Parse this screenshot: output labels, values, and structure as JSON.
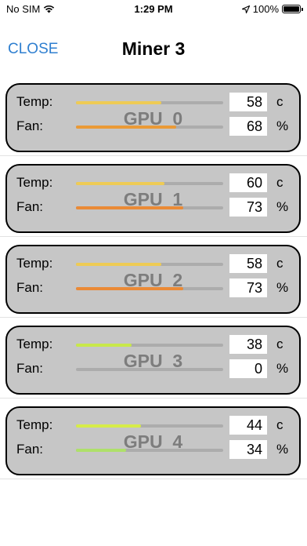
{
  "status_bar": {
    "carrier": "No SIM",
    "time": "1:29 PM",
    "battery": "100%"
  },
  "nav": {
    "close_label": "CLOSE",
    "title": "Miner 3"
  },
  "labels": {
    "temp": "Temp:",
    "fan": "Fan:"
  },
  "gpus": [
    {
      "name": "GPU_0",
      "temp": "58",
      "temp_unit": "c",
      "fan": "68",
      "fan_unit": "%",
      "temp_level": 0.58,
      "fan_level": 0.68,
      "temp_color": "#eecb55",
      "fan_color": "#ea9a36"
    },
    {
      "name": "GPU_1",
      "temp": "60",
      "temp_unit": "c",
      "fan": "73",
      "fan_unit": "%",
      "temp_level": 0.6,
      "fan_level": 0.73,
      "temp_color": "#eecb55",
      "fan_color": "#ea8a36"
    },
    {
      "name": "GPU_2",
      "temp": "58",
      "temp_unit": "c",
      "fan": "73",
      "fan_unit": "%",
      "temp_level": 0.58,
      "fan_level": 0.73,
      "temp_color": "#eecb55",
      "fan_color": "#ea8a36"
    },
    {
      "name": "GPU_3",
      "temp": "38",
      "temp_unit": "c",
      "fan": "0",
      "fan_unit": "%",
      "temp_level": 0.38,
      "fan_level": 0.0,
      "temp_color": "#c8e84a",
      "fan_color": "#c8e84a"
    },
    {
      "name": "GPU_4",
      "temp": "44",
      "temp_unit": "c",
      "fan": "34",
      "fan_unit": "%",
      "temp_level": 0.44,
      "fan_level": 0.34,
      "temp_color": "#d6ec48",
      "fan_color": "#aee06a"
    }
  ]
}
